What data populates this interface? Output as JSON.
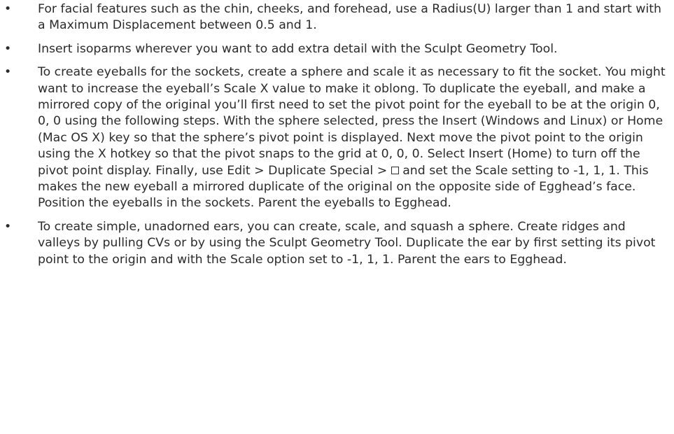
{
  "bullet_glyph": "•",
  "items": [
    {
      "text": "For facial features such as the chin, cheeks, and forehead, use a Radius(U) larger than 1 and start with a Maximum Displacement between 0.5 and 1."
    },
    {
      "text": "Insert isoparms wherever you want to add extra detail with the Sculpt Geometry Tool."
    },
    {
      "text_before_box": "To create eyeballs for the sockets, create a sphere and scale it as necessary to fit the socket. You might want to increase the eyeball’s Scale X value to make it oblong. To duplicate the eyeball, and make a mirrored copy of the original you’ll first need to set the pivot point for the eyeball to be at the origin 0, 0, 0 using the following steps. With the sphere selected, press the Insert (Windows and Linux) or Home (Mac OS X) key so that the sphere’s pivot point is displayed. Next move the pivot point to the origin using the X hotkey so that the pivot snaps to the grid at 0, 0, 0. Select Insert (Home) to turn off the pivot point display. Finally, use Edit > Duplicate Special > ",
      "box_icon": "option-box-icon",
      "text_after_box": " and set the Scale setting to -1, 1, 1. This makes the new eyeball a mirrored duplicate of the original on the opposite side of Egghead’s face. Position the eyeballs in the sockets. Parent the eyeballs to Egghead."
    },
    {
      "text": "To create simple, unadorned ears, you can create, scale, and squash a sphere. Create ridges and valleys by pulling CVs or by using the Sculpt Geometry Tool. Duplicate the ear by first setting its pivot point to the origin and with the Scale option set to -1, 1, 1. Parent the ears to Egghead."
    }
  ]
}
